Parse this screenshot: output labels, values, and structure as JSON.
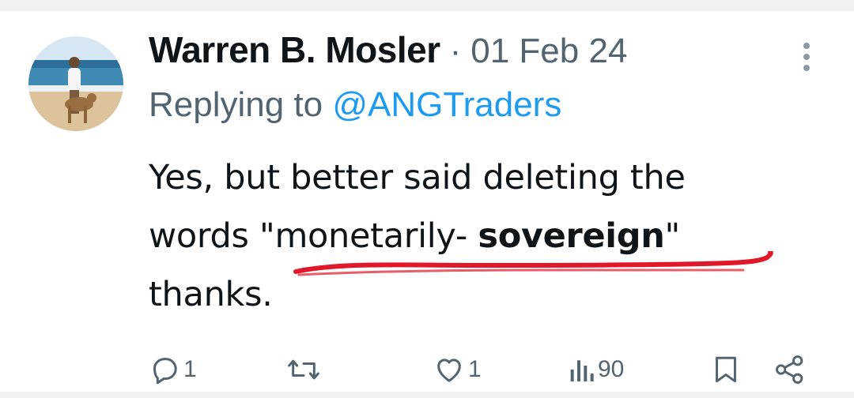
{
  "post": {
    "author_name": "Warren B. Mosler",
    "separator": "·",
    "date": "01 Feb 24",
    "replying_prefix": "Replying to ",
    "replying_handle": "@ANGTraders",
    "body": {
      "line1": "Yes, but better said deleting the",
      "line2_pre": "words \"monetarily- ",
      "line2_bold": "sovereign",
      "line2_post": "\"",
      "line3": "thanks."
    },
    "annotation_color": "#e0182a"
  },
  "actions": {
    "reply_count": "1",
    "like_count": "1",
    "view_count": "90",
    "icons": [
      "reply-icon",
      "repost-icon",
      "like-icon",
      "views-icon",
      "bookmark-icon",
      "share-icon"
    ]
  },
  "colors": {
    "text": "#0f1419",
    "secondary": "#536471",
    "link": "#1d9bf0"
  }
}
